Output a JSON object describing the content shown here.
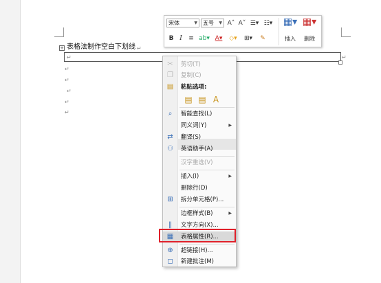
{
  "document": {
    "title_text": "表格法制作空白下划线",
    "anchor_glyph": "+",
    "paragraph_mark": "↵"
  },
  "mini_toolbar": {
    "font_name": "宋体",
    "font_size": "五号",
    "grow_font": "A˄",
    "shrink_font": "A˅",
    "bold": "B",
    "italic": "I",
    "insert_label": "插入",
    "delete_label": "删除"
  },
  "context_menu": {
    "items": [
      {
        "label": "剪切(T)",
        "icon": "scissors-icon",
        "glyph": "✂",
        "disabled": true
      },
      {
        "label": "复制(C)",
        "icon": "copy-icon",
        "glyph": "❐",
        "disabled": true
      },
      {
        "label": "粘贴选项:",
        "icon": "clipboard-icon",
        "glyph": "📋",
        "disabled": false
      },
      {
        "label": "智能查找(L)",
        "icon": "smart-lookup-icon",
        "glyph": "⌕",
        "disabled": false
      },
      {
        "label": "同义词(Y)",
        "icon": "",
        "glyph": "",
        "disabled": false,
        "submenu": true
      },
      {
        "label": "翻译(S)",
        "icon": "translate-icon",
        "glyph": "⇄",
        "disabled": false
      },
      {
        "label": "英语助手(A)",
        "icon": "english-assistant-icon",
        "glyph": "⚇",
        "disabled": false
      },
      {
        "label": "汉字重选(V)",
        "icon": "",
        "glyph": "",
        "disabled": true
      },
      {
        "label": "插入(I)",
        "icon": "",
        "glyph": "",
        "disabled": false,
        "submenu": true
      },
      {
        "label": "删除行(D)",
        "icon": "",
        "glyph": "",
        "disabled": false
      },
      {
        "label": "拆分单元格(P)...",
        "icon": "split-cells-icon",
        "glyph": "⊞",
        "disabled": false
      },
      {
        "label": "边框样式(B)",
        "icon": "",
        "glyph": "",
        "disabled": false,
        "submenu": true
      },
      {
        "label": "文字方向(X)...",
        "icon": "text-direction-icon",
        "glyph": "‖",
        "disabled": false
      },
      {
        "label": "表格属性(R)...",
        "icon": "table-properties-icon",
        "glyph": "▦",
        "disabled": false,
        "active": true
      },
      {
        "label": "超链接(H)...",
        "icon": "hyperlink-icon",
        "glyph": "🌐",
        "disabled": false
      },
      {
        "label": "新建批注(M)",
        "icon": "new-comment-icon",
        "glyph": "◻",
        "disabled": false
      }
    ],
    "submenu_arrow": "▶",
    "paste_options": [
      "📋",
      "📋",
      "A"
    ]
  },
  "colors": {
    "highlight_border": "#e0202a",
    "menu_bg": "#fafafa",
    "icon_blue": "#3a6fb7"
  }
}
